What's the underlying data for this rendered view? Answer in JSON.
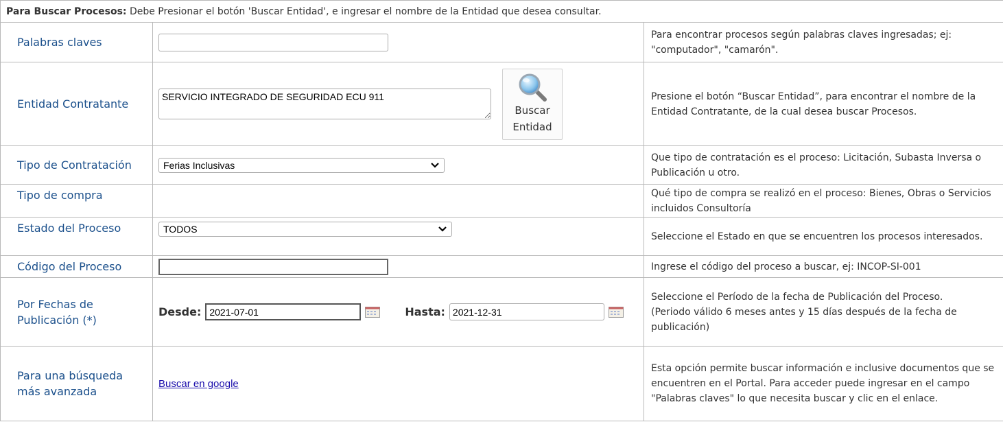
{
  "header": {
    "bold": "Para Buscar Procesos:",
    "text": " Debe Presionar el botón 'Buscar Entidad', e ingresar el nombre de la Entidad que desea consultar."
  },
  "rows": {
    "keywords": {
      "label": "Palabras claves",
      "value": "",
      "desc": "Para encontrar procesos según palabras claves ingresadas; ej: \"computador\", \"camarón\"."
    },
    "entity": {
      "label": "Entidad Contratante",
      "value": "SERVICIO INTEGRADO DE SEGURIDAD ECU 911",
      "button_line1": "Buscar",
      "button_line2": "Entidad",
      "desc": "Presione el botón “Buscar Entidad”, para encontrar el nombre de la Entidad Contratante, de la cual desea buscar Procesos."
    },
    "contract_type": {
      "label": "Tipo de Contratación",
      "selected": "Ferias Inclusivas",
      "desc": "Que tipo de contratación es el proceso: Licitación, Subasta Inversa o Publicación u otro."
    },
    "purchase_type": {
      "label": "Tipo de compra",
      "desc": "Qué tipo de compra se realizó en el proceso: Bienes, Obras o Servicios incluidos Consultoría"
    },
    "status": {
      "label": "Estado del Proceso",
      "selected": "TODOS",
      "desc": "Seleccione el Estado en que se encuentren los procesos interesados."
    },
    "code": {
      "label": "Código del Proceso",
      "value": "",
      "desc": "Ingrese el código del proceso a buscar, ej: INCOP-SI-001"
    },
    "dates": {
      "label": "Por Fechas de Publicación (*)",
      "from_label": "Desde:",
      "from_value": "2021-07-01",
      "to_label": "Hasta:",
      "to_value": "2021-12-31",
      "desc_line1": "Seleccione el Período de la fecha de Publicación del Proceso.",
      "desc_line2": "(Periodo válido 6 meses antes y 15 días después de la fecha de publicación)"
    },
    "advanced": {
      "label": "Para una búsqueda más avanzada",
      "link": "Buscar en google",
      "desc": "Esta opción permite buscar información e inclusive documentos que se encuentren en el Portal. Para acceder puede ingresar en el campo \"Palabras claves\" lo que necesita buscar y clic en el enlace."
    }
  }
}
